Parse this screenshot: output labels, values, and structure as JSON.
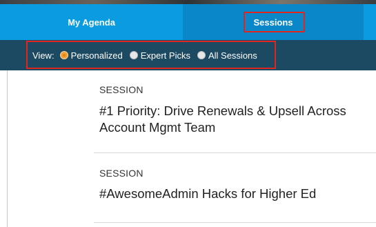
{
  "tabs": {
    "agenda_label": "My Agenda",
    "sessions_label": "Sessions"
  },
  "filter": {
    "view_label": "View:",
    "options": [
      {
        "label": "Personalized",
        "selected": true
      },
      {
        "label": "Expert Picks",
        "selected": false
      },
      {
        "label": "All Sessions",
        "selected": false
      }
    ]
  },
  "sessions": [
    {
      "type": "SESSION",
      "title": "#1 Priority: Drive Renewals & Upsell Across Account Mgmt Team"
    },
    {
      "type": "SESSION",
      "title": "#AwesomeAdmin Hacks for Higher Ed"
    }
  ],
  "colors": {
    "tab_bar": "#0a9be0",
    "tab_active": "#0a87c9",
    "filter_bar": "#1c4a63",
    "highlight": "#e0261f",
    "radio_selected": "#f0a035"
  }
}
